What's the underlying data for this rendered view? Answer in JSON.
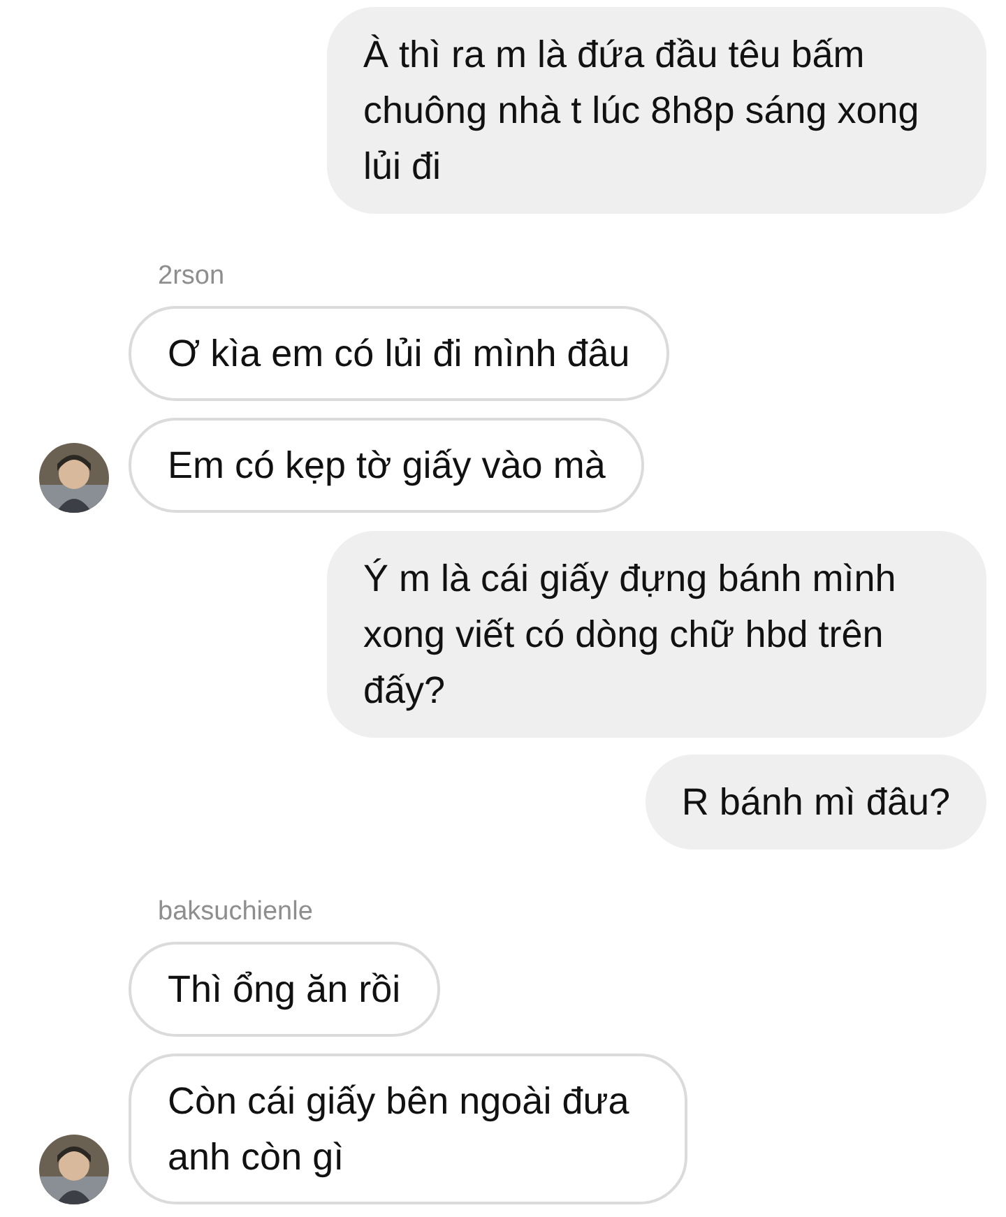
{
  "groups": [
    {
      "kind": "sent",
      "messages": [
        "À thì ra m là đứa đầu têu bấm chuông nhà t lúc 8h8p sáng xong lủi đi"
      ]
    },
    {
      "kind": "received",
      "sender": "2rson",
      "messages": [
        "Ơ kìa em có lủi đi mình đâu",
        "Em có kẹp tờ giấy vào mà"
      ]
    },
    {
      "kind": "sent",
      "messages": [
        "Ý m là cái giấy đựng bánh mình xong viết có dòng chữ hbd trên đấy?",
        "R bánh mì đâu?"
      ]
    },
    {
      "kind": "received",
      "sender": "baksuchienle",
      "messages": [
        "Thì ổng ăn rồi",
        "Còn cái giấy bên ngoài đưa anh còn gì"
      ]
    }
  ]
}
